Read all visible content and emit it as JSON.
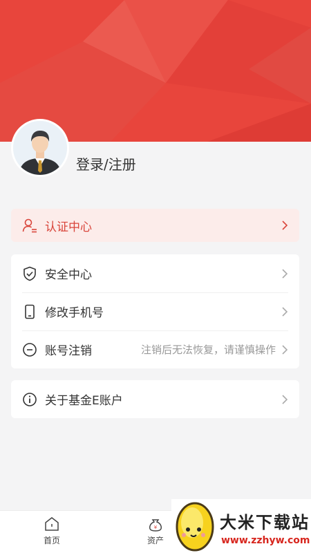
{
  "header": {
    "background_color": "#e8453c"
  },
  "profile": {
    "login_label": "登录/注册",
    "avatar_icon": "user-avatar"
  },
  "auth_center": {
    "label": "认证中心",
    "icon": "user-card-icon"
  },
  "settings": {
    "security": {
      "label": "安全中心",
      "icon": "shield-check-icon"
    },
    "phone": {
      "label": "修改手机号",
      "icon": "phone-icon"
    },
    "cancel": {
      "label": "账号注销",
      "hint": "注销后无法恢复，请谨慎操作",
      "icon": "minus-circle-icon"
    }
  },
  "about": {
    "label": "关于基金E账户",
    "icon": "info-icon"
  },
  "tabbar": {
    "home_label": "首页",
    "assets_label": "资产"
  },
  "watermark": {
    "title": "大米下载站",
    "url": "www.zzhyw.com"
  },
  "colors": {
    "accent": "#e8453c",
    "auth_bg": "#fcecea",
    "page_bg": "#f4f4f5"
  }
}
